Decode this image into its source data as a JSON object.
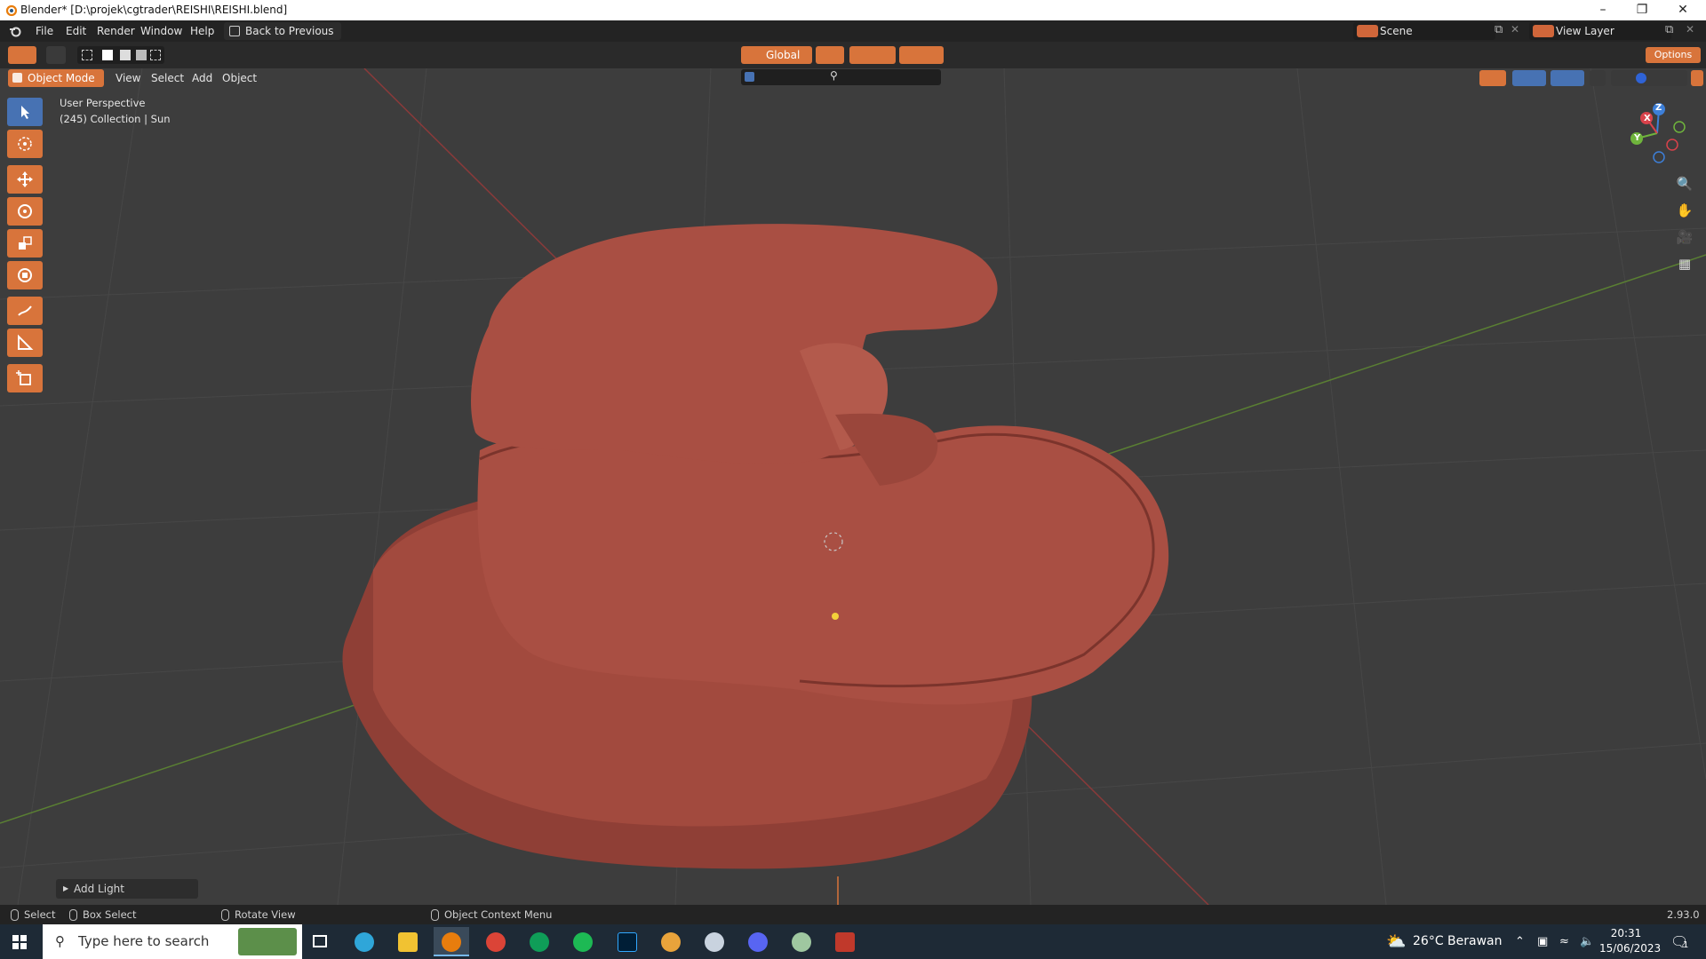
{
  "window": {
    "title": "Blender* [D:\\projek\\cgtrader\\REISHI\\REISHI.blend]"
  },
  "topbar": {
    "menus": [
      "File",
      "Edit",
      "Render",
      "Window",
      "Help"
    ],
    "back_button": "Back to Previous",
    "scene_name": "Scene",
    "view_layer": "View Layer"
  },
  "header": {
    "transform_orientation": "Global",
    "options_label": "Options"
  },
  "header2": {
    "mode": "Object Mode",
    "menus": [
      "View",
      "Select",
      "Add",
      "Object"
    ]
  },
  "viewport": {
    "view_name": "User Perspective",
    "collection_info": "(245) Collection | Sun",
    "gizmo_axes": [
      "Z",
      "Y",
      "X"
    ]
  },
  "operator_panel": {
    "label": "Add Light"
  },
  "statusbar": {
    "select": "Select",
    "box_select": "Box Select",
    "rotate_view": "Rotate View",
    "context_menu": "Object Context Menu",
    "version": "2.93.0"
  },
  "taskbar": {
    "search_placeholder": "Type here to search",
    "weather": "26°C  Berawan",
    "time": "20:31",
    "date": "15/06/2023",
    "notification_count": "1"
  },
  "colors": {
    "accent": "#d8743b",
    "active_tool": "#4772b3",
    "mushroom": "#a24a3e",
    "viewport_bg": "#3d3d3d"
  }
}
